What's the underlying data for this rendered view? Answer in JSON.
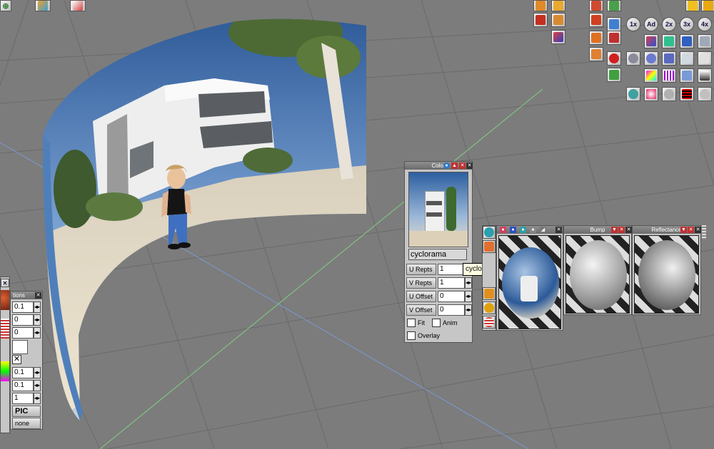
{
  "color_panel": {
    "title": "Color",
    "texture_name": "cyclorama",
    "u_repts": {
      "label": "U Repts",
      "value": "1"
    },
    "v_repts": {
      "label": "V Repts",
      "value": "1"
    },
    "u_offset": {
      "label": "U Offset",
      "value": "0"
    },
    "v_offset": {
      "label": "V Offset",
      "value": "0"
    },
    "fit_label": "Fit",
    "anim_label": "Anim",
    "overlay_label": "Overlay"
  },
  "tooltip": "cyclorama.jpg | Get Texture Map",
  "bump_panel": {
    "title": "Bump"
  },
  "reflectance_panel": {
    "title": "Reflectance"
  },
  "left_panel": {
    "title": "tions",
    "fields": [
      "0.1",
      "0",
      "0",
      "0.1",
      "0.1",
      "1"
    ],
    "pic_label": "PIC",
    "none_label": "none"
  },
  "toolbar": {
    "one_x": "1x",
    "ad": "Ad",
    "two_x": "2x",
    "three_x": "3x",
    "four_x": "4x"
  },
  "colors": {
    "viewport_bg": "#7c7c7c",
    "panel_bg": "#c6c6c6",
    "title_bar": "#6b6b6b"
  }
}
